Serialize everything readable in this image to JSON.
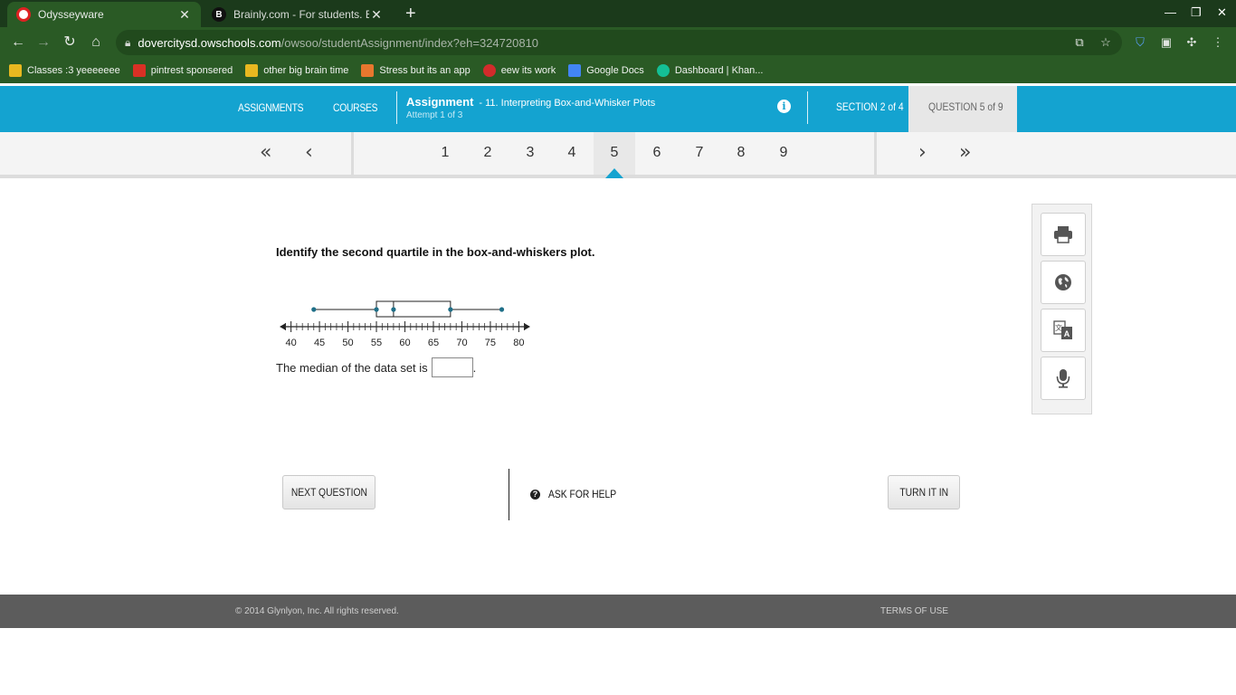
{
  "browser": {
    "tabs": [
      {
        "title": "Odysseyware",
        "active": true
      },
      {
        "title": "Brainly.com - For students. By st",
        "active": false
      }
    ],
    "url_host": "dovercitysd.owschools.com",
    "url_path": "/owsoo/studentAssignment/index?eh=324720810",
    "bookmarks": [
      {
        "label": "Classes :3 yeeeeeee",
        "color": "#e8b820"
      },
      {
        "label": "pintrest sponsered",
        "color": "#d93025"
      },
      {
        "label": "other big brain time",
        "color": "#e8b820"
      },
      {
        "label": "Stress but its an app",
        "color": "#e8772e"
      },
      {
        "label": "eew its work",
        "color": "#d22b2b"
      },
      {
        "label": "Google Docs",
        "color": "#4285f4"
      },
      {
        "label": "Dashboard | Khan...",
        "color": "#14bf96"
      }
    ]
  },
  "header": {
    "assignments": "ASSIGNMENTS",
    "courses": "COURSES",
    "assignment_label": "Assignment",
    "assignment_name": "- 11. Interpreting Box-and-Whisker Plots",
    "attempt": "Attempt 1 of 3",
    "section": "SECTION 2 of 4",
    "question": "QUESTION 5 of 9"
  },
  "pager": {
    "pages": [
      "1",
      "2",
      "3",
      "4",
      "5",
      "6",
      "7",
      "8",
      "9"
    ],
    "current": "5"
  },
  "question": {
    "prompt": "Identify the second quartile in the box-and-whiskers plot.",
    "answer_prefix": "The median of the data set is",
    "answer_suffix": ".",
    "answer_value": ""
  },
  "chart_data": {
    "type": "boxplot",
    "axis_ticks": [
      40,
      45,
      50,
      55,
      60,
      65,
      70,
      75,
      80
    ],
    "xlim": [
      38,
      82
    ],
    "minor_step": 1,
    "min": 44,
    "q1": 55,
    "median": 58,
    "q3": 68,
    "max": 77
  },
  "tools": [
    "printer-icon",
    "globe-icon",
    "translate-icon",
    "microphone-icon"
  ],
  "actions": {
    "next": "NEXT QUESTION",
    "help": "ASK FOR HELP",
    "turn_in": "TURN IT IN"
  },
  "footer": {
    "copyright": "© 2014 Glynlyon, Inc. All rights reserved.",
    "terms": "TERMS OF USE"
  },
  "colors": {
    "accent": "#14a3d0",
    "chrome": "#2a5a25",
    "plot_point": "#1f6f88"
  }
}
